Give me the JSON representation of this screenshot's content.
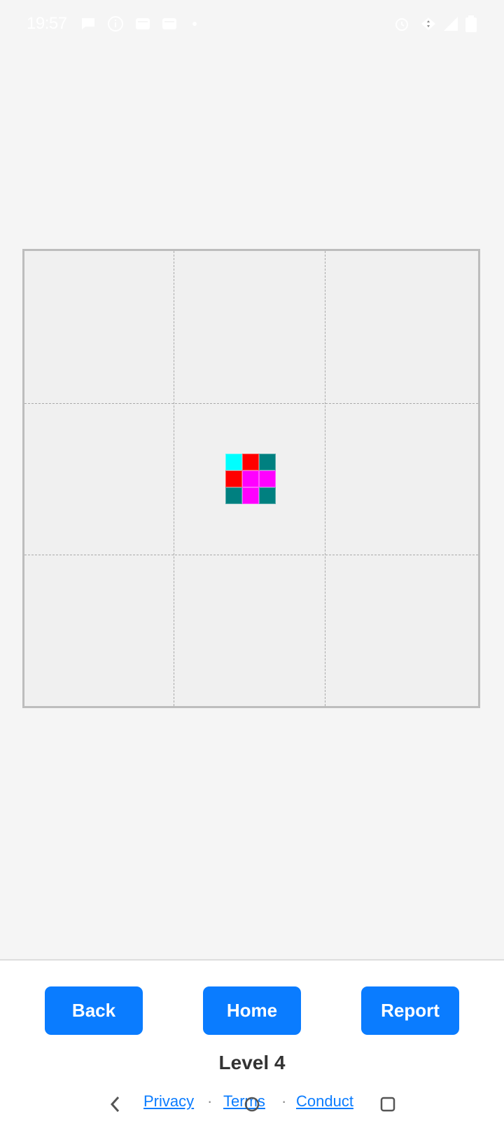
{
  "status_bar": {
    "time": "19:57",
    "left_icons": [
      "chat-bubble-icon",
      "info-icon",
      "inbox-icon",
      "inbox-icon",
      "dot-icon"
    ],
    "right_icons": [
      "alarm-icon",
      "wifi-icon",
      "signal-icon",
      "battery-icon"
    ]
  },
  "board": {
    "grid": "3x3",
    "piece_colors": [
      [
        "#00ffff",
        "#ff0000",
        "#008080"
      ],
      [
        "#ff0000",
        "#ff00ff",
        "#ff00ff"
      ],
      [
        "#008080",
        "#ff00ff",
        "#008080"
      ]
    ]
  },
  "controls": {
    "back_label": "Back",
    "home_label": "Home",
    "report_label": "Report"
  },
  "level_label": "Level 4",
  "footer": {
    "privacy": "Privacy",
    "terms": "Terms",
    "conduct": "Conduct",
    "separator": "·"
  },
  "nav_bar": [
    "back-nav-icon",
    "home-nav-icon",
    "recents-nav-icon"
  ],
  "colors": {
    "accent": "#0a7cff",
    "background": "#f5f5f5",
    "board_bg": "#f0f0f0"
  }
}
